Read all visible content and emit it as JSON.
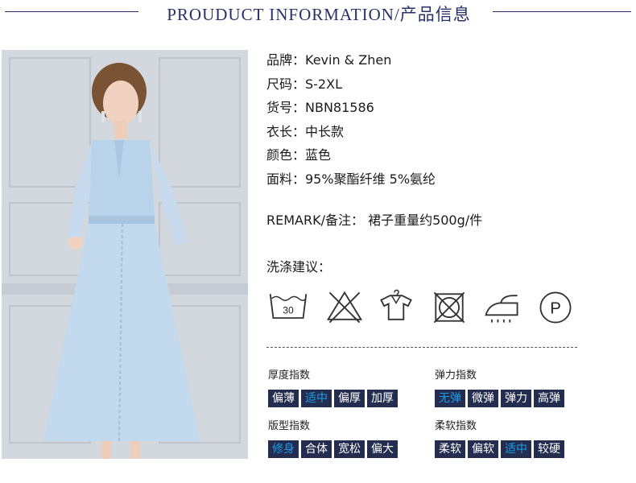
{
  "header": {
    "title": "PROUDUCT INFORMATION/产品信息"
  },
  "product_info": {
    "brand": "品牌：Kevin & Zhen",
    "size": "尺码：S-2XL",
    "item_no": "货号：NBN81586",
    "length": "衣长：中长款",
    "color": "颜色：蓝色",
    "fabric": "面料：95%聚酯纤维 5%氨纶"
  },
  "remark": "REMARK/备注：  裙子重量约500g/件",
  "wash": {
    "title": "洗涤建议：",
    "icons": [
      "wash-30-icon",
      "do-not-bleach-icon",
      "hang-dry-icon",
      "do-not-tumble-dry-icon",
      "low-iron-icon",
      "dry-clean-p-icon"
    ],
    "temp_label": "30",
    "dryclean_label": "P"
  },
  "indices": {
    "thickness": {
      "title": "厚度指数",
      "options": [
        "偏薄",
        "适中",
        "偏厚",
        "加厚"
      ],
      "selected": 1
    },
    "elasticity": {
      "title": "弹力指数",
      "options": [
        "无弹",
        "微弹",
        "弹力",
        "高弹"
      ],
      "selected": 0
    },
    "fit": {
      "title": "版型指数",
      "options": [
        "修身",
        "合体",
        "宽松",
        "偏大"
      ],
      "selected": 0
    },
    "softness": {
      "title": "柔软指数",
      "options": [
        "柔软",
        "偏软",
        "适中",
        "较硬"
      ],
      "selected": 2
    }
  },
  "colors": {
    "navy": "#232d4f",
    "accent": "#1e9be8",
    "header": "#27306b",
    "dress": "#b9d3ea"
  }
}
